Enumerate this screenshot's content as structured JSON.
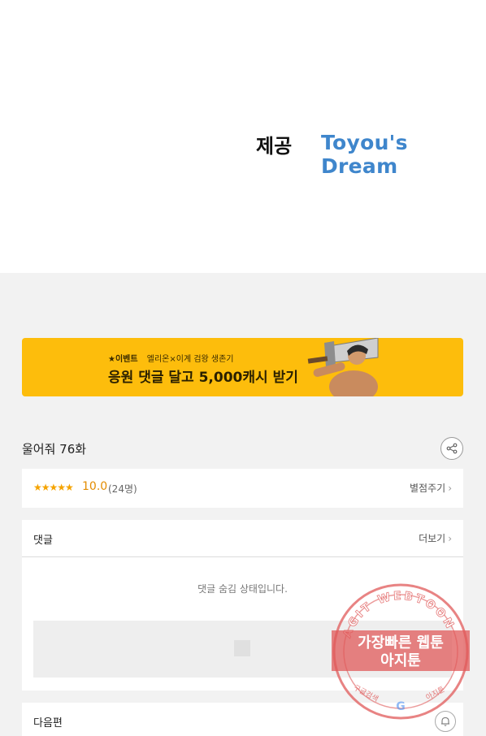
{
  "credits": {
    "provided_by_label": "제공",
    "brand_name": "Toyou's Dream"
  },
  "banner": {
    "event_tag": "★이벤트",
    "subtitle": "엘리온×이계 검왕 생존기",
    "headline": "응원 댓글 달고 5,000캐시 받기"
  },
  "episode": {
    "title": "울어줘 76화"
  },
  "rating": {
    "stars": "★★★★★",
    "score": "10.0",
    "count": "(24명)",
    "rate_link": "별점주기"
  },
  "comments": {
    "title": "댓글",
    "more_link": "더보기",
    "hidden_message": "댓글 숨김 상태입니다."
  },
  "next": {
    "title": "다음편"
  },
  "watermark": {
    "ring_text": "AGIT WEBTOON",
    "line1": "가장빠른 웹툰",
    "line2": "아지툰",
    "bottom_left": "구글검색",
    "bottom_right": "아지툰"
  },
  "colors": {
    "banner_bg": "#fdbd0c",
    "brand_blue": "#3f86cc",
    "star_orange": "#f5a300",
    "watermark_red": "#e05a5a"
  }
}
